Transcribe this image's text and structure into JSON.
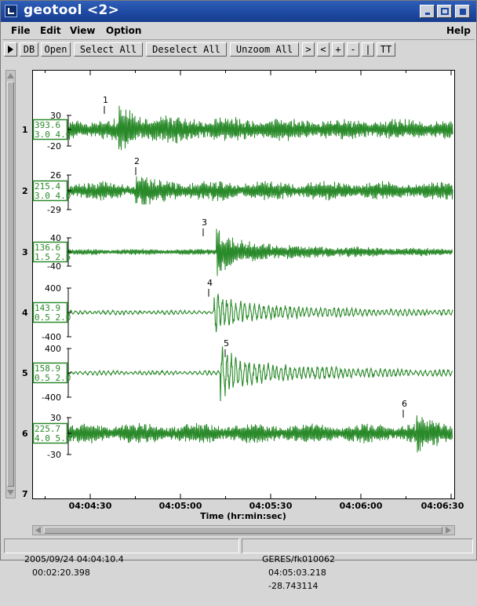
{
  "window": {
    "title": "geotool <2>"
  },
  "menubar": {
    "items": [
      "File",
      "Edit",
      "View",
      "Option"
    ],
    "help": "Help"
  },
  "toolbar": {
    "buttons": [
      "DB",
      "Open",
      "Select All",
      "Deselect All",
      "Unzoom All",
      ">",
      "<",
      "+",
      "-",
      "|",
      "TT"
    ]
  },
  "waveforms": [
    {
      "row": "1",
      "ytop": "30",
      "ybottom": "-20",
      "amp": "393.6",
      "filter": "3.0 4.0",
      "pick": "1"
    },
    {
      "row": "2",
      "ytop": "26",
      "ybottom": "-29",
      "amp": "215.4",
      "filter": "3.0 4.0",
      "pick": "2"
    },
    {
      "row": "3",
      "ytop": "40",
      "ybottom": "-40",
      "amp": "136.6",
      "filter": "1.5 2.5",
      "pick": "3"
    },
    {
      "row": "4",
      "ytop": "400",
      "ybottom": "-400",
      "amp": "143.9",
      "filter": "0.5 2.0",
      "pick": "4"
    },
    {
      "row": "5",
      "ytop": "400",
      "ybottom": "-400",
      "amp": "158.9",
      "filter": "0.5 2.0",
      "pick": "5"
    },
    {
      "row": "6",
      "ytop": "30",
      "ybottom": "-30",
      "amp": "225.7",
      "filter": "4.0 5.0",
      "pick": "6"
    }
  ],
  "extra_row_label": "7",
  "time_axis": {
    "ticks": [
      "04:04:30",
      "04:05:00",
      "04:05:30",
      "04:06:00",
      "04:06:30"
    ],
    "label": "Time (hr:min:sec)"
  },
  "status": {
    "datetime": "2005/09/24 04:04:10.4",
    "duration": "00:02:20.398",
    "station": "GERES/fk010062",
    "cursor_time": "04:05:03.218",
    "cursor_value": "-28.743114"
  },
  "colors": {
    "trace": "#2a8a2a",
    "titlebar": "#1f4aa3",
    "label_box": "#2a8a2a"
  }
}
